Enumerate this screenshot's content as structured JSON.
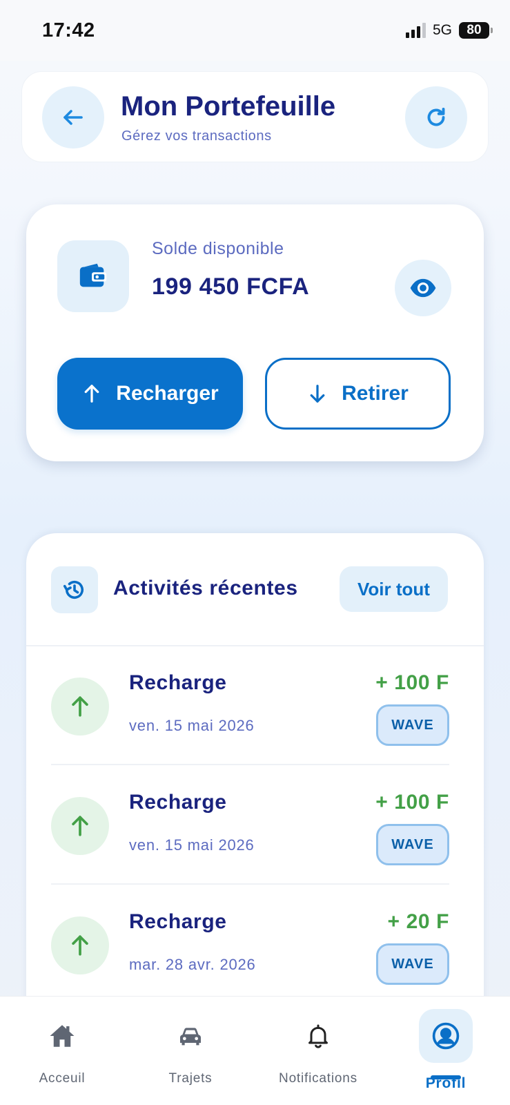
{
  "status_bar": {
    "time": "17:42",
    "network": "5G",
    "battery": "80"
  },
  "header": {
    "title": "Mon Portefeuille",
    "subtitle": "Gérez vos transactions",
    "back_icon": "arrow-left-icon",
    "refresh_icon": "refresh-icon"
  },
  "balance": {
    "label": "Solde disponible",
    "amount": "199 450 FCFA",
    "wallet_icon": "wallet-icon",
    "visibility_icon": "eye-icon",
    "recharge_label": "Recharger",
    "withdraw_label": "Retirer"
  },
  "activities": {
    "title": "Activités récentes",
    "see_all_label": "Voir tout",
    "items": [
      {
        "title": "Recharge",
        "date": "ven. 15 mai 2026",
        "amount": "+ 100 F",
        "method": "WAVE"
      },
      {
        "title": "Recharge",
        "date": "ven. 15 mai 2026",
        "amount": "+ 100 F",
        "method": "WAVE"
      },
      {
        "title": "Recharge",
        "date": "mar. 28 avr. 2026",
        "amount": "+ 20 F",
        "method": "WAVE"
      }
    ]
  },
  "tab_bar": {
    "tabs": [
      {
        "label": "Acceuil",
        "icon": "home-icon"
      },
      {
        "label": "Trajets",
        "icon": "car-icon"
      },
      {
        "label": "Notifications",
        "icon": "bell-icon"
      },
      {
        "label": "Profil",
        "icon": "profile-icon",
        "active": true
      }
    ]
  },
  "colors": {
    "primary": "#0a72cc",
    "title": "#1a237e",
    "secondary_text": "#5c6bc0",
    "credit": "#43a047",
    "icon_bg": "#e3f0fa"
  }
}
